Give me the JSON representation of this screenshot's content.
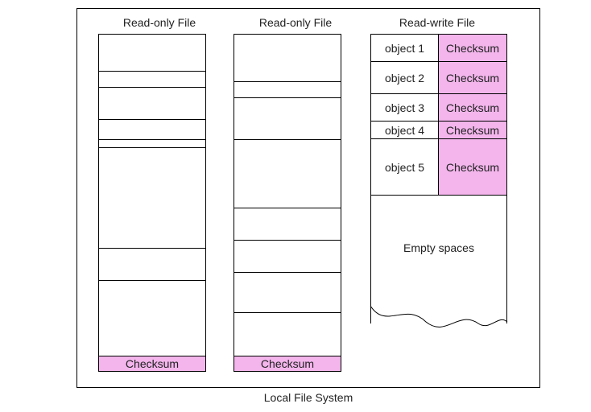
{
  "caption": "Local File System",
  "columns": {
    "left": {
      "title": "Read-only File",
      "checksum": "Checksum"
    },
    "mid": {
      "title": "Read-only File",
      "checksum": "Checksum"
    },
    "right": {
      "title": "Read-write File"
    }
  },
  "rw_rows": [
    {
      "object": "object 1",
      "checksum": "Checksum"
    },
    {
      "object": "object 2",
      "checksum": "Checksum"
    },
    {
      "object": "object 3",
      "checksum": "Checksum"
    },
    {
      "object": "object 4",
      "checksum": "Checksum"
    },
    {
      "object": "object 5",
      "checksum": "Checksum"
    }
  ],
  "empty_label": "Empty spaces",
  "colors": {
    "checksum_bg": "#f3b5ec"
  }
}
